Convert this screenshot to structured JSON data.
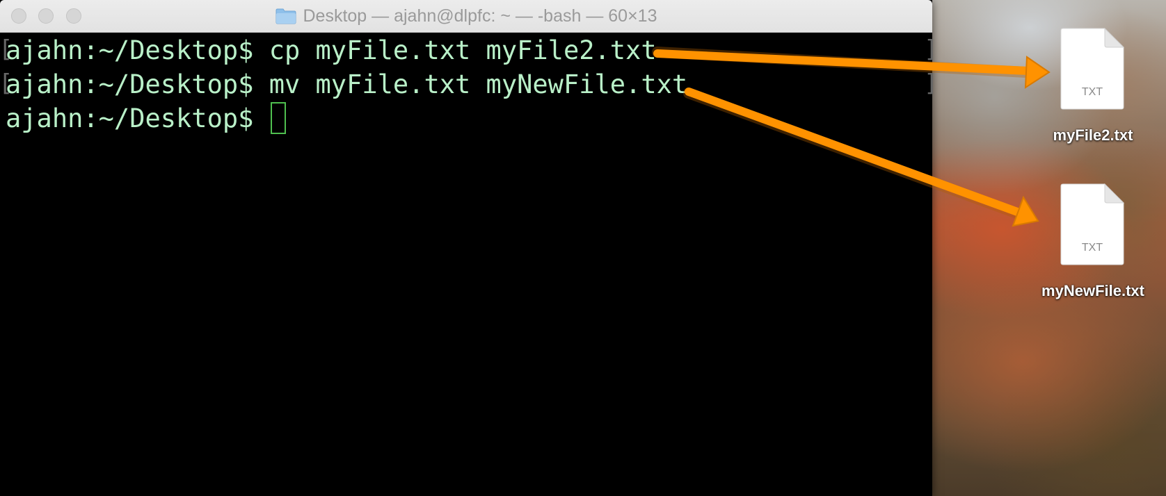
{
  "window": {
    "title": "Desktop — ajahn@dlpfc: ~ — -bash — 60×13"
  },
  "terminal": {
    "lines": [
      {
        "prompt": "ajahn:~/Desktop$",
        "command": " cp myFile.txt myFile2.txt"
      },
      {
        "prompt": "ajahn:~/Desktop$",
        "command": " mv myFile.txt myNewFile.txt"
      },
      {
        "prompt": "ajahn:~/Desktop$",
        "command": " "
      }
    ],
    "text_color": "#b9f0c8",
    "cursor_color": "#4fbf4f"
  },
  "desktop": {
    "files": [
      {
        "ext": "TXT",
        "name": "myFile2.txt"
      },
      {
        "ext": "TXT",
        "name": "myNewFile.txt"
      }
    ]
  },
  "annotations": {
    "arrow_color": "#ff9200"
  }
}
